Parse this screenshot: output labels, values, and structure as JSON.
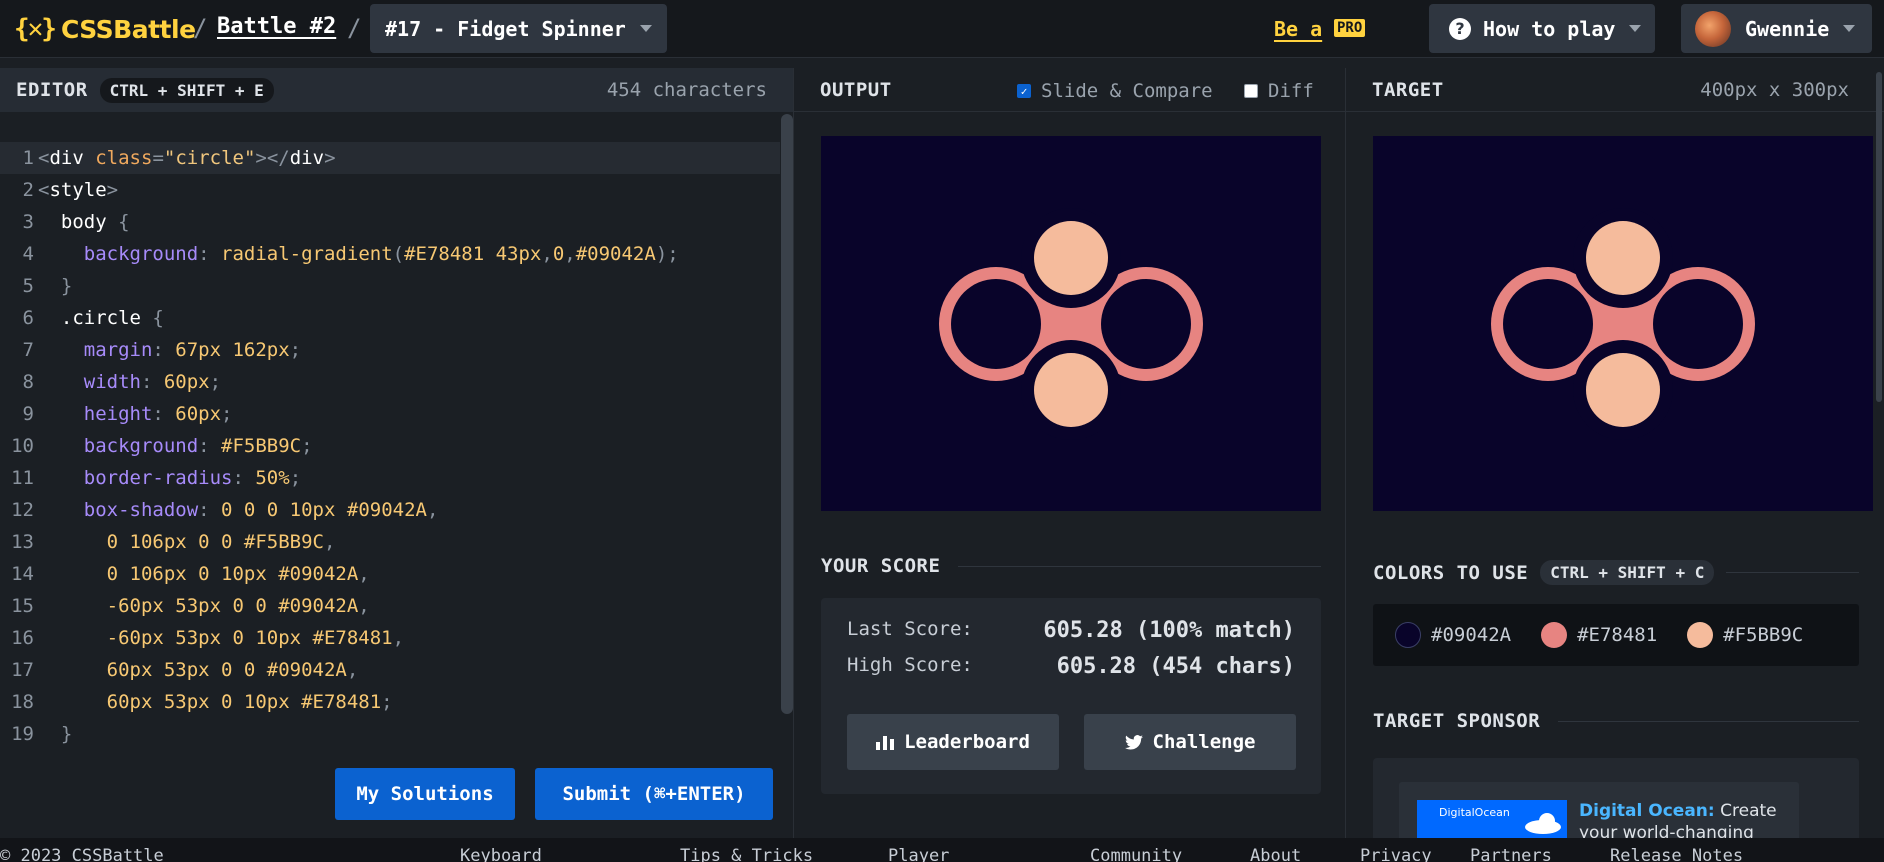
{
  "header": {
    "logo_mark": "{✕}",
    "logo_text": "CSSBattle",
    "sep": "/",
    "battle_link": "Battle #2",
    "challenge_select": "#17 - Fidget Spinner",
    "be_a": "Be a",
    "pro": "PRO",
    "how_to_play": "How to play",
    "help_glyph": "?",
    "user_name": "Gwennie"
  },
  "editor": {
    "title": "EDITOR",
    "shortcut": "CTRL + SHIFT + E",
    "char_count": "454 characters",
    "line_numbers": [
      "1",
      "2",
      "3",
      "4",
      "5",
      "6",
      "7",
      "8",
      "9",
      "10",
      "11",
      "12",
      "13",
      "14",
      "15",
      "16",
      "17",
      "18",
      "19"
    ],
    "lines": [
      [
        [
          "<",
          "punct"
        ],
        [
          "div",
          "tag"
        ],
        [
          " ",
          "plain"
        ],
        [
          "class",
          "attr"
        ],
        [
          "=",
          "punct"
        ],
        [
          "\"circle\"",
          "str"
        ],
        [
          "></",
          "punct"
        ],
        [
          "div",
          "tag"
        ],
        [
          ">",
          "punct"
        ]
      ],
      [
        [
          "<",
          "punct"
        ],
        [
          "style",
          "tag"
        ],
        [
          ">",
          "punct"
        ]
      ],
      [
        [
          "  body ",
          "sel"
        ],
        [
          "{",
          "punct"
        ]
      ],
      [
        [
          "    background",
          "prop"
        ],
        [
          ": ",
          "punct"
        ],
        [
          "radial-gradient",
          "val"
        ],
        [
          "(",
          "punct"
        ],
        [
          "#E78481 43px",
          "val"
        ],
        [
          ",",
          "punct"
        ],
        [
          "0",
          "val"
        ],
        [
          ",",
          "punct"
        ],
        [
          "#09042A",
          "val"
        ],
        [
          ");",
          "punct"
        ]
      ],
      [
        [
          "  }",
          "punct"
        ]
      ],
      [
        [
          "  .circle ",
          "sel"
        ],
        [
          "{",
          "punct"
        ]
      ],
      [
        [
          "    margin",
          "prop"
        ],
        [
          ": ",
          "punct"
        ],
        [
          "67px 162px",
          "val"
        ],
        [
          ";",
          "punct"
        ]
      ],
      [
        [
          "    width",
          "prop"
        ],
        [
          ": ",
          "punct"
        ],
        [
          "60px",
          "val"
        ],
        [
          ";",
          "punct"
        ]
      ],
      [
        [
          "    height",
          "prop"
        ],
        [
          ": ",
          "punct"
        ],
        [
          "60px",
          "val"
        ],
        [
          ";",
          "punct"
        ]
      ],
      [
        [
          "    background",
          "prop"
        ],
        [
          ": ",
          "punct"
        ],
        [
          "#F5BB9C",
          "val"
        ],
        [
          ";",
          "punct"
        ]
      ],
      [
        [
          "    border-radius",
          "prop"
        ],
        [
          ": ",
          "punct"
        ],
        [
          "50%",
          "val"
        ],
        [
          ";",
          "punct"
        ]
      ],
      [
        [
          "    box-shadow",
          "prop"
        ],
        [
          ": ",
          "punct"
        ],
        [
          "0 0 0 10px #09042A",
          "val"
        ],
        [
          ",",
          "punct"
        ]
      ],
      [
        [
          "      0 106px 0 0 #F5BB9C",
          "val"
        ],
        [
          ",",
          "punct"
        ]
      ],
      [
        [
          "      0 106px 0 10px #09042A",
          "val"
        ],
        [
          ",",
          "punct"
        ]
      ],
      [
        [
          "      -60px 53px 0 0 #09042A",
          "val"
        ],
        [
          ",",
          "punct"
        ]
      ],
      [
        [
          "      -60px 53px 0 10px #E78481",
          "val"
        ],
        [
          ",",
          "punct"
        ]
      ],
      [
        [
          "      60px 53px 0 0 #09042A",
          "val"
        ],
        [
          ",",
          "punct"
        ]
      ],
      [
        [
          "      60px 53px 0 10px #E78481",
          "val"
        ],
        [
          ";",
          "punct"
        ]
      ],
      [
        [
          "  }",
          "punct"
        ]
      ]
    ],
    "my_solutions": "My Solutions",
    "submit": "Submit (⌘+ENTER)"
  },
  "output": {
    "title": "OUTPUT",
    "slide_compare": "Slide & Compare",
    "slide_compare_checked": true,
    "diff": "Diff",
    "diff_checked": false,
    "check_glyph": "✓"
  },
  "score": {
    "title": "YOUR SCORE",
    "last_label": "Last Score:",
    "last_value": "605.28 (100% match)",
    "high_label": "High Score:",
    "high_value": "605.28 (454 chars)",
    "leaderboard": "Leaderboard",
    "challenge": "Challenge"
  },
  "target": {
    "title": "TARGET",
    "size": "400px x 300px",
    "colors_title": "COLORS TO USE",
    "colors_shortcut": "CTRL + SHIFT + C",
    "colors": [
      {
        "hex": "#09042A",
        "label": "#09042A"
      },
      {
        "hex": "#E78481",
        "label": "#E78481"
      },
      {
        "hex": "#F5BB9C",
        "label": "#F5BB9C"
      }
    ],
    "sponsor_title": "TARGET SPONSOR",
    "sponsor_img_text": "DigitalOcean",
    "sponsor_brand": "Digital Ocean:",
    "sponsor_text": "Create your world-changing"
  },
  "palette": {
    "bg": "#09042A",
    "ring": "#E78481",
    "circle": "#F5BB9C"
  },
  "footer": {
    "copyright": "© 2023 CSSBattle",
    "keyboard": "Keyboard",
    "tips": "Tips & Tricks",
    "player": "Player",
    "faq": "Community",
    "about": "About",
    "privacy": "Privacy",
    "partners": "Partners",
    "release": "Release Notes"
  }
}
